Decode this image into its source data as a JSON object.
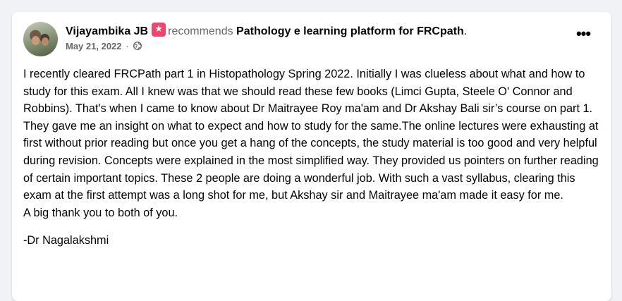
{
  "post": {
    "author": "Vijayambika JB",
    "recommends_label": "recommends",
    "page_name": "Pathology e learning platform for FRCpath",
    "page_suffix": ".",
    "date": "May 21, 2022",
    "separator": "·",
    "more_label": "•••",
    "paragraphs": [
      "I recently cleared FRCPath part 1 in Histopathology Spring 2022. Initially I was clueless about what and how to study for this exam. All I knew was that we should read these few books (Limci Gupta, Steele O' Connor and Robbins). That's when I came to know about Dr Maitrayee Roy ma'am and Dr Akshay Bali sir’s course on part 1. They gave me an insight on what to expect and how to study for the same.The online lectures were exhausting at first without prior reading but once you get a hang of the concepts, the study material is too good and very helpful during revision. Concepts were explained in the most simplified way. They provided us pointers on further reading of certain important topics. These 2 people are doing a wonderful  job. With such a vast syllabus, clearing this exam at the first attempt was a long shot for me, but Akshay sir and Maitrayee ma'am made it easy for me.",
      "A big thank you to both of you."
    ],
    "signoff": "-Dr Nagalakshmi"
  },
  "icons": {
    "recommend": "recommend-star-icon",
    "privacy": "globe-icon",
    "more": "more-options-icon"
  },
  "colors": {
    "background": "#f0f2f5",
    "card": "#ffffff",
    "text_primary": "#050505",
    "text_secondary": "#65676b",
    "recommend_badge": "#f0466e"
  }
}
